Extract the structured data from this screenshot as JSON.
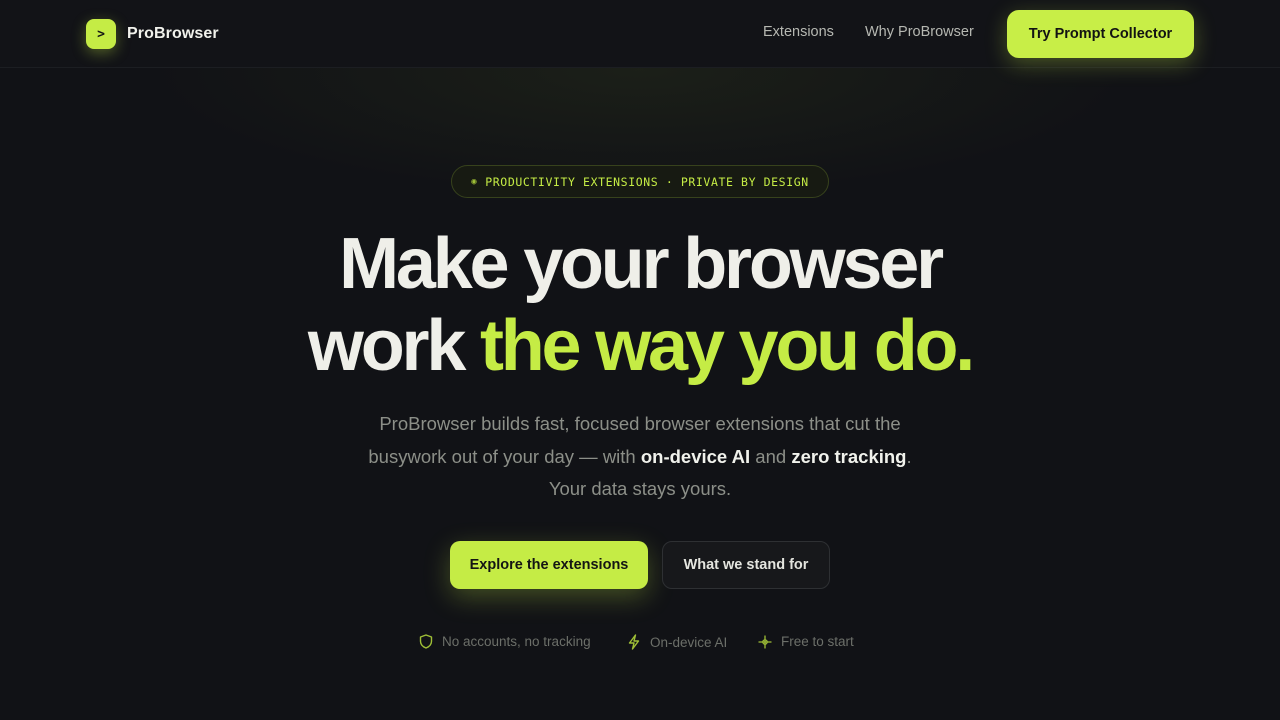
{
  "nav": {
    "brand_logo": ">",
    "brand_name": "ProBrowser",
    "links": [
      "Extensions",
      "Why ProBrowser"
    ],
    "cta_label": "Try Prompt Collector"
  },
  "hero": {
    "pill_text": "PRODUCTIVITY EXTENSIONS · PRIVATE BY DESIGN",
    "headline_line1": "Make your browser",
    "headline_line2_plain": "work ",
    "headline_line2_accent": "the way you do.",
    "sub": {
      "line1": "ProBrowser builds fast, focused browser extensions that cut the",
      "line2_pre": "busywork out of your day — with ",
      "line2_strong1": "on-device AI",
      "line2_mid": " and ",
      "line2_strong2": "zero tracking",
      "line2_post": ".",
      "line3": "Your data stays yours."
    },
    "primary_button": "Explore the extensions",
    "secondary_button": "What we stand for",
    "features": [
      {
        "icon": "shield-icon",
        "label": "No accounts, no tracking"
      },
      {
        "icon": "lightning-icon",
        "label": "On-device AI"
      },
      {
        "icon": "sparkle-icon",
        "label": "Free to start"
      }
    ]
  },
  "colors": {
    "accent": "#c5ec45",
    "background": "#111216",
    "text": "#efefe9"
  }
}
